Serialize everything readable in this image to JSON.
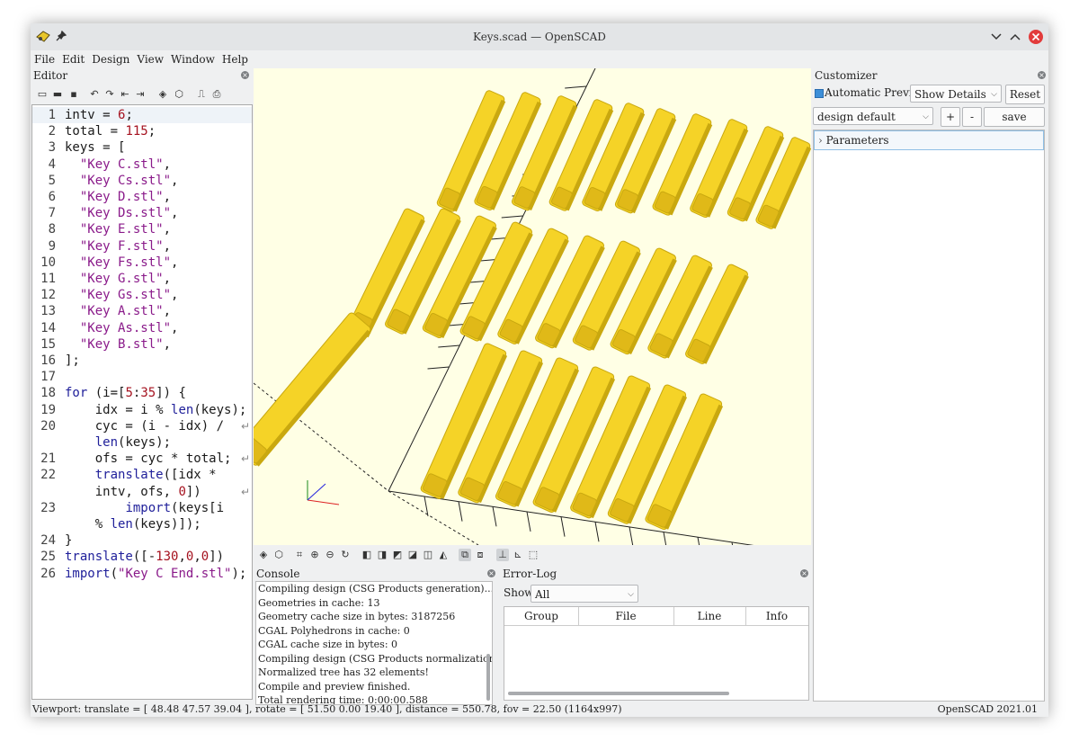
{
  "window": {
    "title": "Keys.scad — OpenSCAD"
  },
  "menu": [
    "File",
    "Edit",
    "Design",
    "View",
    "Window",
    "Help"
  ],
  "editor": {
    "title": "Editor",
    "lines": [
      {
        "n": "1",
        "html": "intv = <span class='num'>6</span>;"
      },
      {
        "n": "2",
        "html": "total = <span class='num'>115</span>;"
      },
      {
        "n": "3",
        "html": "keys = ["
      },
      {
        "n": "4",
        "html": "  <span class='str'>\"Key C.stl\"</span>,"
      },
      {
        "n": "5",
        "html": "  <span class='str'>\"Key Cs.stl\"</span>,"
      },
      {
        "n": "6",
        "html": "  <span class='str'>\"Key D.stl\"</span>,"
      },
      {
        "n": "7",
        "html": "  <span class='str'>\"Key Ds.stl\"</span>,"
      },
      {
        "n": "8",
        "html": "  <span class='str'>\"Key E.stl\"</span>,"
      },
      {
        "n": "9",
        "html": "  <span class='str'>\"Key F.stl\"</span>,"
      },
      {
        "n": "10",
        "html": "  <span class='str'>\"Key Fs.stl\"</span>,"
      },
      {
        "n": "11",
        "html": "  <span class='str'>\"Key G.stl\"</span>,"
      },
      {
        "n": "12",
        "html": "  <span class='str'>\"Key Gs.stl\"</span>,"
      },
      {
        "n": "13",
        "html": "  <span class='str'>\"Key A.stl\"</span>,"
      },
      {
        "n": "14",
        "html": "  <span class='str'>\"Key As.stl\"</span>,"
      },
      {
        "n": "15",
        "html": "  <span class='str'>\"Key B.stl\"</span>,"
      },
      {
        "n": "16",
        "html": "];"
      },
      {
        "n": "17",
        "html": ""
      },
      {
        "n": "18",
        "html": "<span class='kw'>for</span> (i=[<span class='num'>5</span>:<span class='num'>35</span>]) {"
      },
      {
        "n": "19",
        "html": "    idx = i % <span class='fn'>len</span>(keys);"
      },
      {
        "n": "20",
        "html": "    cyc = (i - idx) /"
      },
      {
        "n": "",
        "html": "    <span class='fn'>len</span>(keys);"
      },
      {
        "n": "21",
        "html": "    ofs = cyc * total;"
      },
      {
        "n": "22",
        "html": "    <span class='fn'>translate</span>([idx *"
      },
      {
        "n": "",
        "html": "    intv, ofs, <span class='num'>0</span>])"
      },
      {
        "n": "23",
        "html": "        <span class='fn'>import</span>(keys[i"
      },
      {
        "n": "",
        "html": "    % <span class='fn'>len</span>(keys)]);"
      },
      {
        "n": "24",
        "html": "}"
      },
      {
        "n": "25",
        "html": "<span class='fn'>translate</span>([-<span class='num'>130</span>,<span class='num'>0</span>,<span class='num'>0</span>])"
      },
      {
        "n": "26",
        "html": "<span class='fn'>import</span>(<span class='str'>\"Key C End.stl\"</span>);"
      }
    ]
  },
  "console": {
    "title": "Console",
    "lines": [
      "Compiling design (CSG Products generation)...",
      "Geometries in cache: 13",
      "Geometry cache size in bytes: 3187256",
      "CGAL Polyhedrons in cache: 0",
      "CGAL cache size in bytes: 0",
      "Compiling design (CSG Products normalization)...",
      "Normalized tree has 32 elements!",
      "Compile and preview finished.",
      "Total rendering time: 0:00:00.588"
    ]
  },
  "errorlog": {
    "title": "Error-Log",
    "show_label": "Show",
    "show_value": "All",
    "columns": [
      "Group",
      "File",
      "Line",
      "Info"
    ]
  },
  "customizer": {
    "title": "Customizer",
    "auto_preview": "Automatic Preview",
    "details": "Show Details",
    "reset": "Reset",
    "preset": "design default values",
    "plus": "+",
    "minus": "-",
    "save": "save preset",
    "parameters": "Parameters"
  },
  "status": {
    "viewport": "Viewport: translate = [ 48.48 47.57 39.04 ], rotate = [ 51.50 0.00 19.40 ], distance = 550.78, fov = 22.50 (1164x997)",
    "version": "OpenSCAD 2021.01"
  },
  "colors": {
    "model": "#f5d327",
    "model_dark": "#c9a80f",
    "viewport_bg": "#ffffe5",
    "close": "#e23b3b"
  }
}
